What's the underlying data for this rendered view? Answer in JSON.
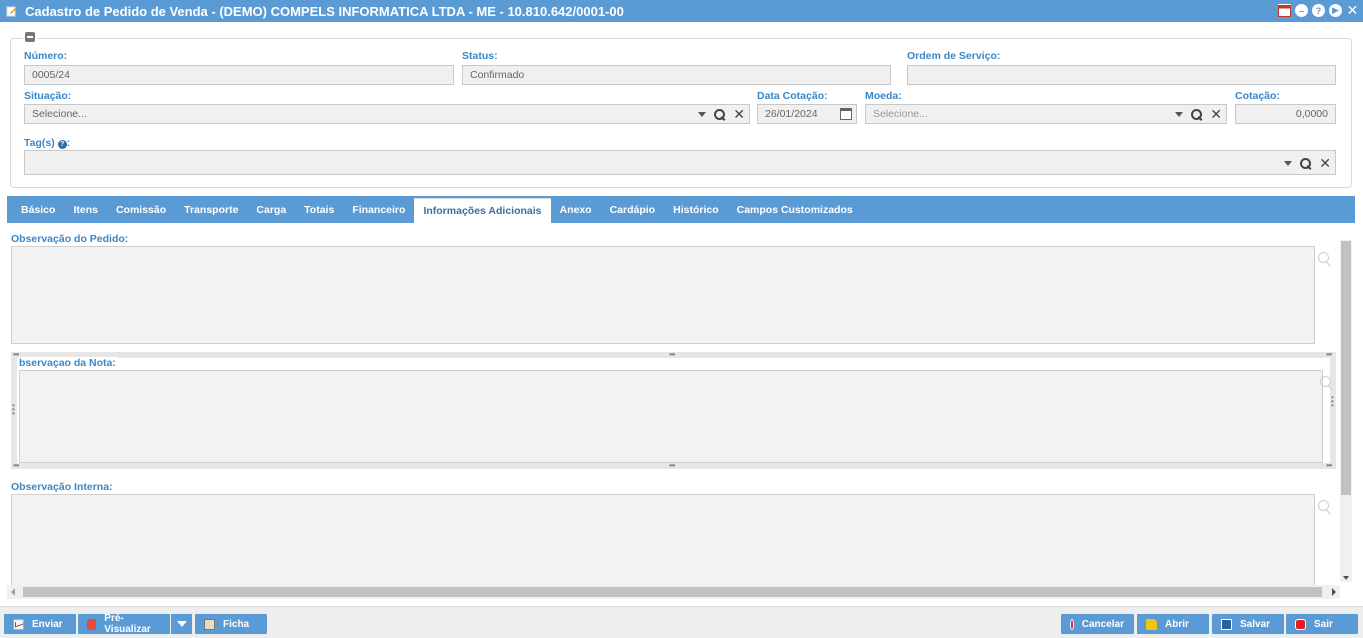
{
  "window": {
    "title": "Cadastro de Pedido de Venda - (DEMO) COMPELS INFORMATICA LTDA - ME - 10.810.642/0001-00"
  },
  "header": {
    "numero_label": "Número:",
    "numero_value": "0005/24",
    "status_label": "Status:",
    "status_value": "Confirmado",
    "ordem_label": "Ordem de Serviço:",
    "ordem_value": "",
    "situacao_label": "Situação:",
    "situacao_placeholder": "Selecione...",
    "data_cotacao_label": "Data Cotação:",
    "data_cotacao_value": "26/01/2024",
    "moeda_label": "Moeda:",
    "moeda_placeholder": "Selecione...",
    "cotacao_label": "Cotação:",
    "cotacao_value": "0,0000",
    "tags_label": "Tag(s)",
    "tags_help": "?",
    "tags_colon": ":"
  },
  "tabs": [
    {
      "label": "Básico"
    },
    {
      "label": "Itens"
    },
    {
      "label": "Comissão"
    },
    {
      "label": "Transporte"
    },
    {
      "label": "Carga"
    },
    {
      "label": "Totais"
    },
    {
      "label": "Financeiro"
    },
    {
      "label": "Informações Adicionais",
      "active": true
    },
    {
      "label": "Anexo"
    },
    {
      "label": "Cardápio"
    },
    {
      "label": "Histórico"
    },
    {
      "label": "Campos Customizados"
    }
  ],
  "content": {
    "obs_pedido_label": "Observação do Pedido:",
    "obs_nota_label": "bservaçao da Nota:",
    "obs_interna_label": "Observação Interna:"
  },
  "footer": {
    "enviar": "Enviar",
    "pre_visualizar": "Pré-Visualizar",
    "ficha": "Ficha",
    "cancelar": "Cancelar",
    "abrir": "Abrir",
    "salvar": "Salvar",
    "sair": "Sair"
  },
  "colors": {
    "accent": "#5b9bd5",
    "label": "#3a87c8"
  }
}
